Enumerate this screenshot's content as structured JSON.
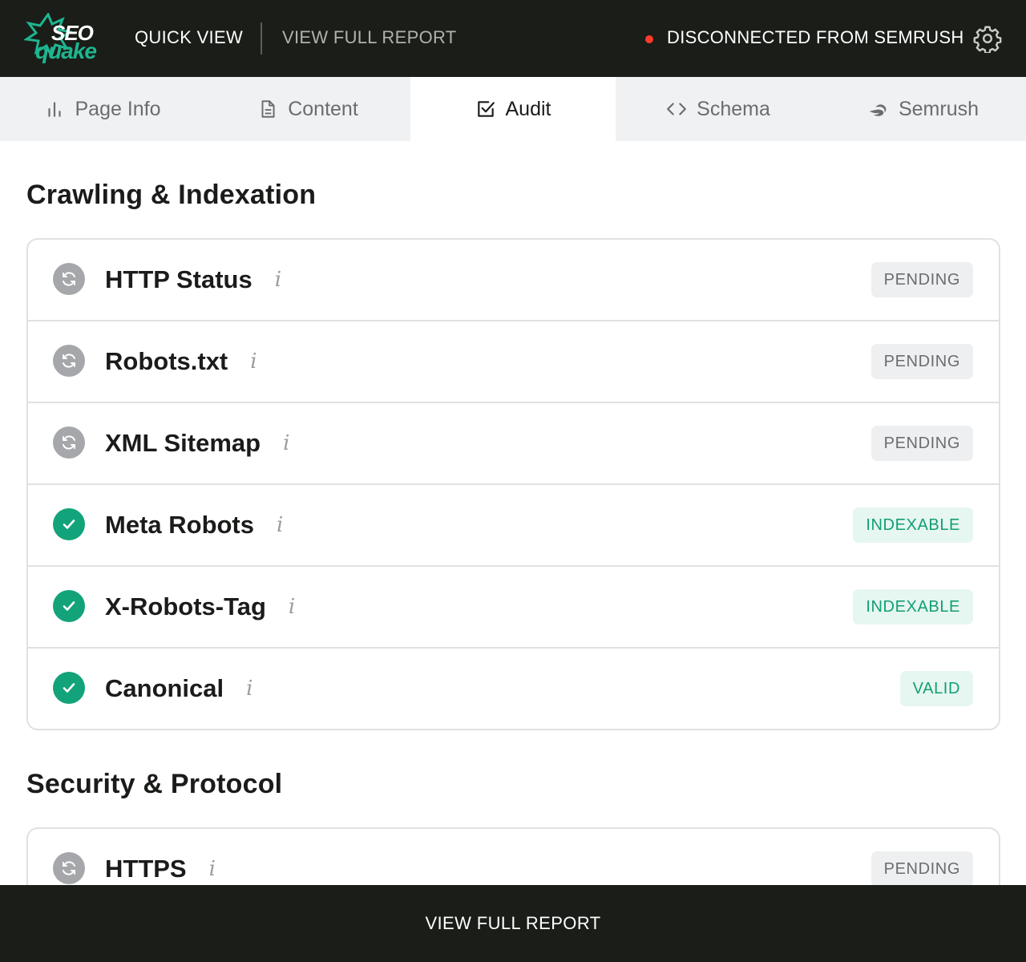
{
  "header": {
    "logo_top": "SEO",
    "logo_bottom": "quake",
    "quick_view": "QUICK VIEW",
    "view_full_report": "VIEW FULL REPORT",
    "connection_status": "DISCONNECTED FROM SEMRUSH",
    "connection_color": "#ff3a2e",
    "settings_icon": "gear-icon"
  },
  "tabs": [
    {
      "label": "Page Info",
      "icon": "bar-chart-icon",
      "active": false
    },
    {
      "label": "Content",
      "icon": "document-icon",
      "active": false
    },
    {
      "label": "Audit",
      "icon": "checkbox-icon",
      "active": true
    },
    {
      "label": "Schema",
      "icon": "code-icon",
      "active": false
    },
    {
      "label": "Semrush",
      "icon": "semrush-icon",
      "active": false
    }
  ],
  "sections": [
    {
      "title": "Crawling & Indexation",
      "rows": [
        {
          "label": "HTTP Status",
          "status": "pending",
          "badge": "PENDING"
        },
        {
          "label": "Robots.txt",
          "status": "pending",
          "badge": "PENDING"
        },
        {
          "label": "XML Sitemap",
          "status": "pending",
          "badge": "PENDING"
        },
        {
          "label": "Meta Robots",
          "status": "ok",
          "badge": "INDEXABLE"
        },
        {
          "label": "X-Robots-Tag",
          "status": "ok",
          "badge": "INDEXABLE"
        },
        {
          "label": "Canonical",
          "status": "ok",
          "badge": "VALID"
        }
      ]
    },
    {
      "title": "Security & Protocol",
      "rows": [
        {
          "label": "HTTPS",
          "status": "pending",
          "badge": "PENDING"
        }
      ]
    }
  ],
  "info_glyph": "i",
  "footer": {
    "label": "VIEW FULL REPORT"
  },
  "colors": {
    "header_bg": "#1a1d18",
    "accent_green": "#12a37a",
    "pending_grey": "#a5a7aa"
  }
}
